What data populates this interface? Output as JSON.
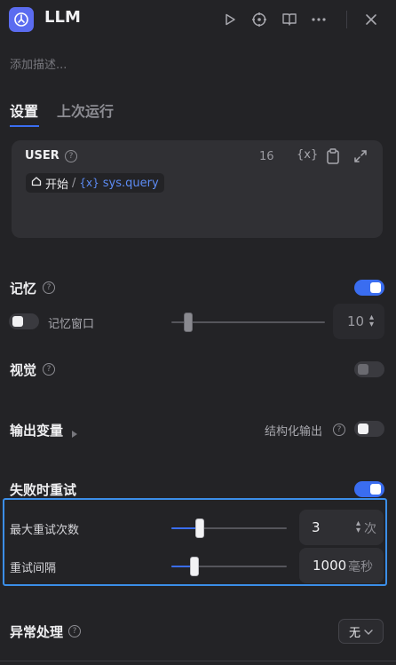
{
  "header": {
    "title": "LLM",
    "description_placeholder": "添加描述..."
  },
  "tabs": [
    {
      "label": "设置",
      "active": true
    },
    {
      "label": "上次运行",
      "active": false
    }
  ],
  "prompt": {
    "role": "USER",
    "token_count": "16",
    "variable": {
      "node": "开始",
      "separator": "/",
      "x_symbol": "{x}",
      "name": "sys.query"
    }
  },
  "memory": {
    "label": "记忆",
    "enabled": true,
    "window_label": "记忆窗口",
    "window_enabled": false,
    "window_value": "10",
    "window_slider_fraction": 0.1
  },
  "vision": {
    "label": "视觉",
    "enabled": false
  },
  "output_vars": {
    "label": "输出变量",
    "structured_label": "结构化输出",
    "structured_enabled": false
  },
  "retry": {
    "label": "失败时重试",
    "enabled": true,
    "max_retries_label": "最大重试次数",
    "max_retries_value": "3",
    "max_retries_unit": "次",
    "max_retries_slider_fraction": 0.3,
    "interval_label": "重试间隔",
    "interval_value": "1000",
    "interval_unit": "毫秒",
    "interval_slider_fraction": 0.2
  },
  "error_handling": {
    "label": "异常处理",
    "selected": "无"
  },
  "colors": {
    "accent": "#3a6df0",
    "highlight_border": "#3b8ee8",
    "background": "#232326",
    "panel": "#303034"
  },
  "icons": [
    "llm-app-icon",
    "play-icon",
    "crosshair-icon",
    "book-icon",
    "more-icon",
    "close-icon",
    "help-icon",
    "variable-icon",
    "clipboard-icon",
    "expand-icon",
    "home-icon",
    "spinner-icon",
    "chevron-down-icon"
  ]
}
